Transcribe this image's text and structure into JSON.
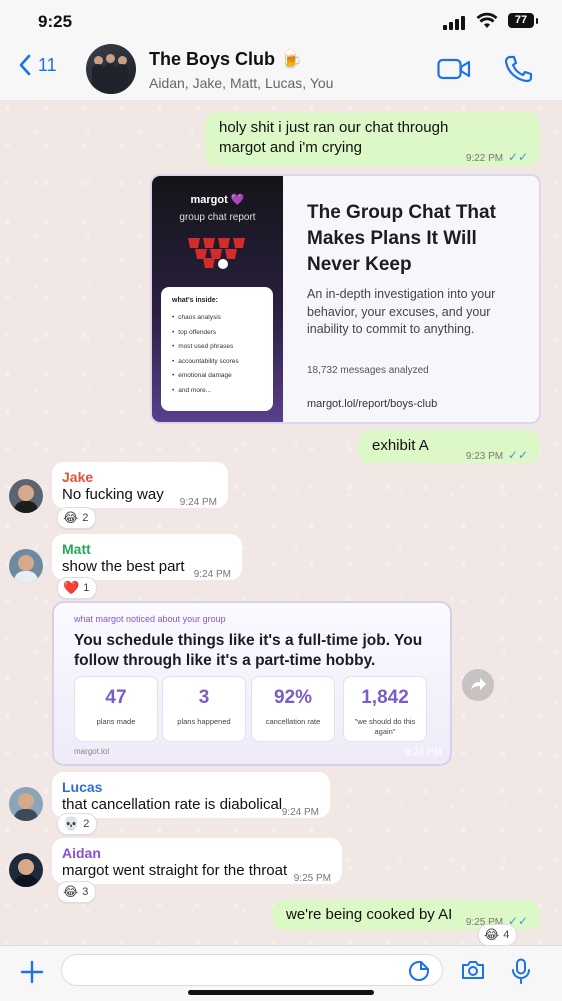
{
  "status_bar": {
    "time": "9:25",
    "battery": "77"
  },
  "header": {
    "back_count": "11",
    "title": "The Boys Club 🍺",
    "members": "Aidan, Jake, Matt, Lucas, You"
  },
  "messages": {
    "m1": {
      "text": "holy shit i just ran our chat through margot and i'm crying",
      "time": "9:22 PM"
    },
    "report": {
      "brand": "margot 💜",
      "brand_sub": "group chat report",
      "inside_title": "what's inside:",
      "inside_items": [
        "chaos analysis",
        "top offenders",
        "most used phrases",
        "accountability scores",
        "emotional damage",
        "and more..."
      ],
      "title": "The Group Chat That Makes Plans It Will Never Keep",
      "description": "An in-depth investigation into your behavior, your excuses, and your inability to commit to anything.",
      "count": "18,732 messages analyzed",
      "url": "margot.lol/report/boys-club"
    },
    "m2": {
      "text": "exhibit A",
      "time": "9:23 PM"
    },
    "m3": {
      "sender": "Jake",
      "text": "No fucking way",
      "time": "9:24 PM",
      "reaction": "😂",
      "reaction_count": "2"
    },
    "m4": {
      "sender": "Matt",
      "text": "show the best part",
      "time": "9:24 PM",
      "reaction": "❤️",
      "reaction_count": "1"
    },
    "insight": {
      "label": "what margot noticed about your group",
      "headline": "You schedule things like it's a full-time job. You follow through like it's a part-time hobby.",
      "stats": [
        {
          "num": "47",
          "label": "plans made"
        },
        {
          "num": "3",
          "label": "plans happened"
        },
        {
          "num": "92%",
          "label": "cancellation rate"
        },
        {
          "num": "1,842",
          "label": "\"we should do this again\""
        }
      ],
      "footer": "margot.lol",
      "time": "9:24 PM"
    },
    "m5": {
      "sender": "Lucas",
      "text": "that cancellation rate is diabolical",
      "time": "9:24 PM",
      "reaction": "💀",
      "reaction_count": "2"
    },
    "m6": {
      "sender": "Aidan",
      "text": "margot went straight for the throat",
      "time": "9:25 PM",
      "reaction": "😂",
      "reaction_count": "3"
    },
    "m7": {
      "text": "we're being cooked by AI",
      "time": "9:25 PM",
      "reaction": "😂",
      "reaction_count": "4"
    }
  },
  "colors": {
    "jake": "#e0543c",
    "matt": "#2aa65a",
    "lucas": "#2f6fd0",
    "aidan": "#8a4fd6",
    "accent": "#1a73e8",
    "stat_number": "#7a5cc8"
  },
  "icons": [
    "back-chevron-icon",
    "video-call-icon",
    "phone-icon",
    "forward-icon",
    "plus-icon",
    "sticker-icon",
    "camera-icon",
    "microphone-icon",
    "read-ticks-icon"
  ]
}
